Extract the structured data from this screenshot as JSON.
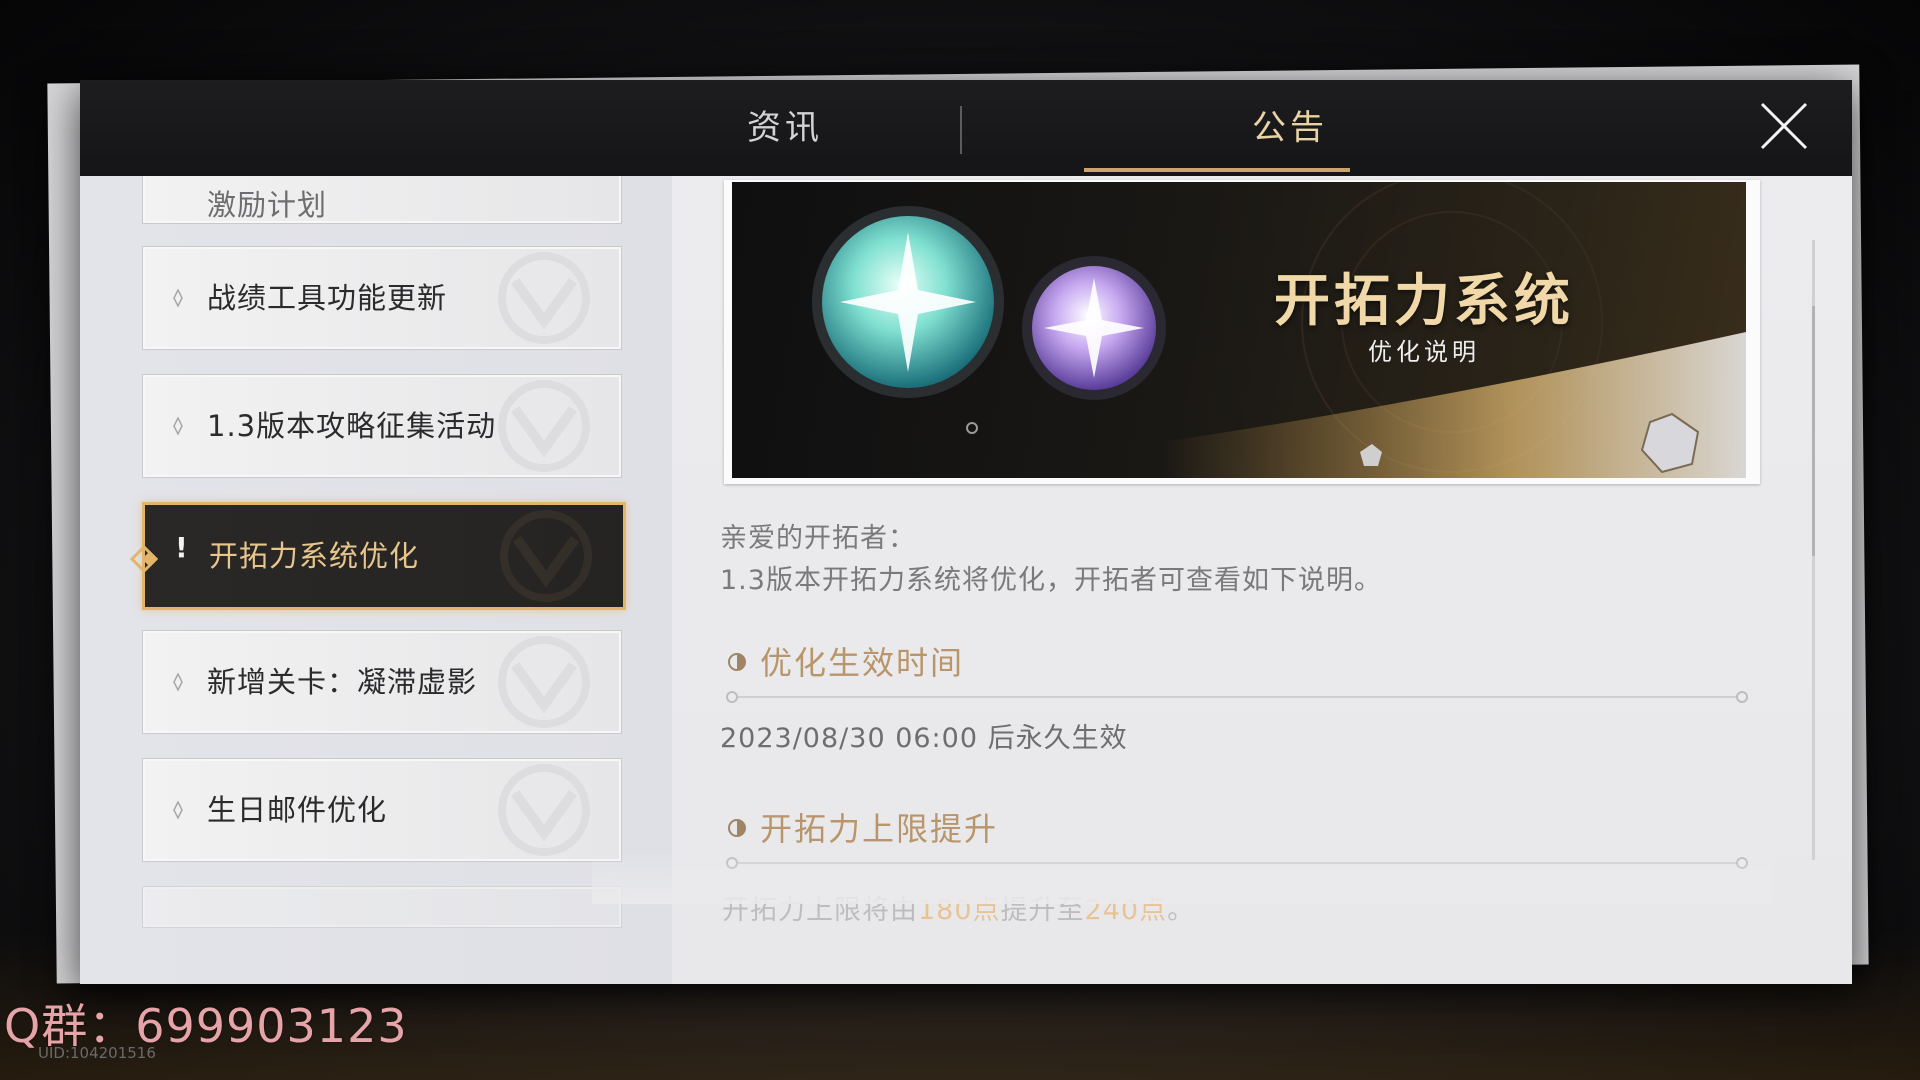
{
  "tabs": {
    "news_label": "资讯",
    "notice_label": "公告"
  },
  "sidebar": {
    "items": [
      {
        "label": "激励计划",
        "state": "partial"
      },
      {
        "label": "战绩工具功能更新"
      },
      {
        "label": "1.3版本攻略征集活动"
      },
      {
        "label": "开拓力系统优化",
        "active": true,
        "badge": "!"
      },
      {
        "label": "新增关卡：凝滞虚影"
      },
      {
        "label": "生日邮件优化"
      }
    ]
  },
  "banner": {
    "title": "开拓力系统",
    "subtitle": "优化说明"
  },
  "article": {
    "greeting": "亲爱的开拓者：",
    "intro": "1.3版本开拓力系统将优化，开拓者可查看如下说明。",
    "sections": [
      {
        "heading": "优化生效时间",
        "body": "2023/08/30 06:00 后永久生效"
      },
      {
        "heading": "开拓力上限提升",
        "body_prefix": "开拓力上限将由",
        "value_from": "180点",
        "body_mid": "提升至",
        "value_to": "240点",
        "body_suffix": "。"
      }
    ]
  },
  "overlay": {
    "watermark": "Q群：699903123",
    "uid": "UID:104201516"
  },
  "colors": {
    "accent_gold": "#c9a36a",
    "highlight_orange": "#e8a552",
    "active_border": "#e2b56a"
  },
  "icons": [
    "close-icon",
    "diamond-marker-icon",
    "half-circle-icon",
    "emblem-icon"
  ]
}
